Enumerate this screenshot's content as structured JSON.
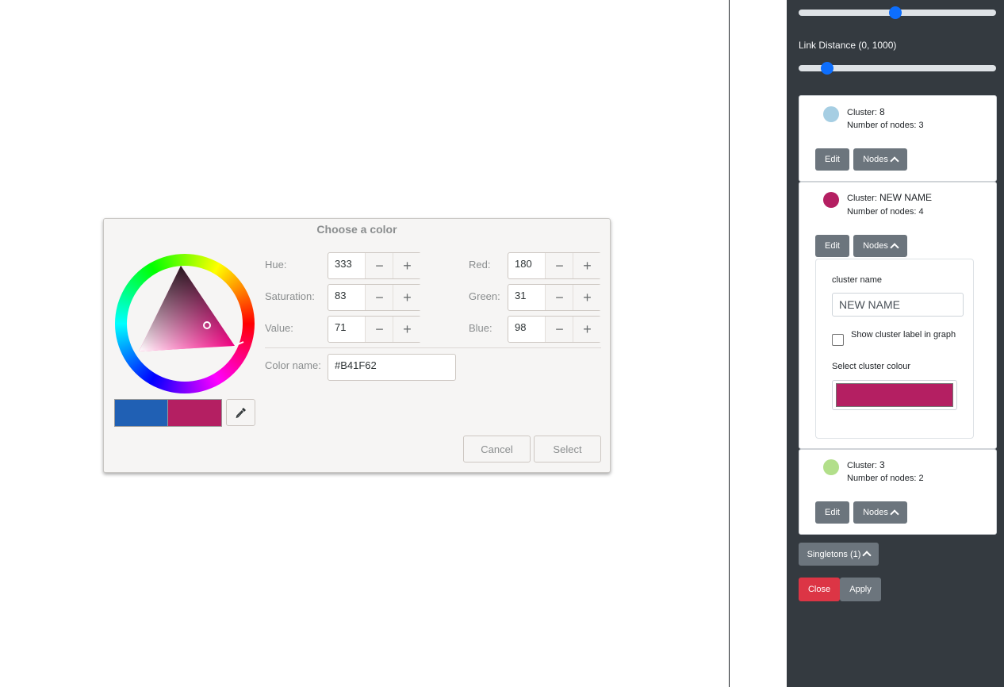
{
  "sidebar": {
    "link_distance_label": "Link Distance (0, 1000)",
    "slider_top_value": 0.49,
    "slider_link_distance_value": 0.12,
    "clusters": [
      {
        "label": "Cluster:",
        "name": "8",
        "nodes_label": "Number of nodes:",
        "nodes": "3",
        "color": "#a6cee3",
        "edit": "Edit",
        "nodes_btn": "Nodes"
      },
      {
        "label": "Cluster:",
        "name": "NEW NAME",
        "nodes_label": "Number of nodes:",
        "nodes": "4",
        "color": "#b41f62",
        "edit": "Edit",
        "nodes_btn": "Nodes",
        "edit_panel": {
          "cluster_name_label": "cluster name",
          "cluster_name_value": "NEW NAME",
          "show_label_text": "Show cluster label in graph",
          "show_label_checked": false,
          "select_colour_label": "Select cluster colour",
          "selected_colour": "#b41f62"
        }
      },
      {
        "label": "Cluster:",
        "name": "3",
        "nodes_label": "Number of nodes:",
        "nodes": "2",
        "color": "#b2df8a",
        "edit": "Edit",
        "nodes_btn": "Nodes"
      }
    ],
    "singletons_btn": "Singletons (1)",
    "close_btn": "Close",
    "apply_btn": "Apply"
  },
  "dialog": {
    "title": "Choose a color",
    "hue_label": "Hue:",
    "hue": "333",
    "saturation_label": "Saturation:",
    "saturation": "83",
    "value_label": "Value:",
    "value": "71",
    "red_label": "Red:",
    "red": "180",
    "green_label": "Green:",
    "green": "31",
    "blue_label": "Blue:",
    "blue": "98",
    "color_name_label": "Color name:",
    "color_name": "#B41F62",
    "old_color": "#2060b4",
    "new_color": "#b41f62",
    "cancel": "Cancel",
    "select": "Select"
  }
}
